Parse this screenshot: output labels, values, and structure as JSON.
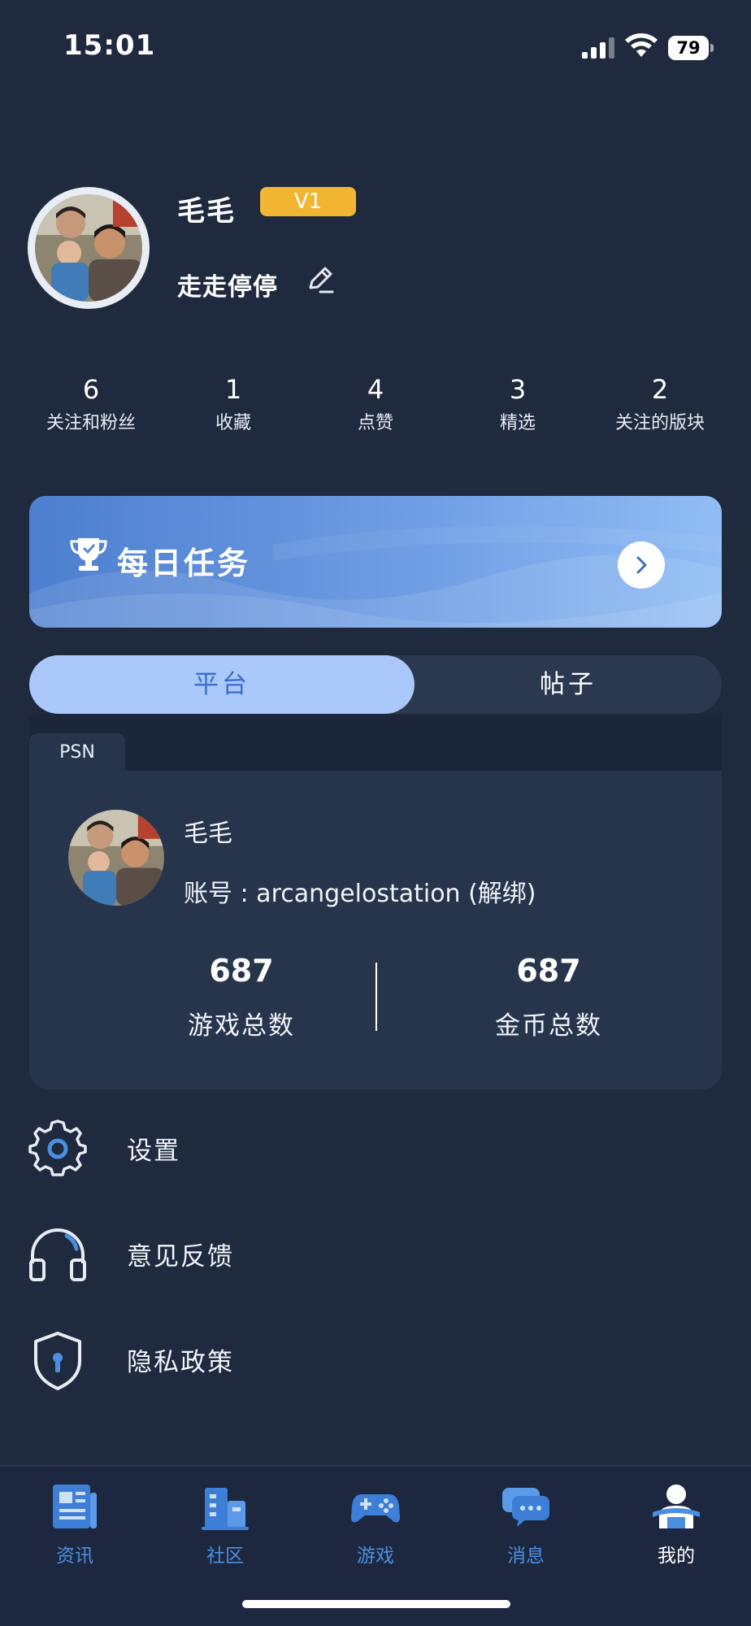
{
  "status_bar": {
    "time": "15:01",
    "battery": "79"
  },
  "profile": {
    "name": "毛毛",
    "level": "V1",
    "signature": "走走停停"
  },
  "stats": [
    {
      "value": "6",
      "label": "关注和粉丝"
    },
    {
      "value": "1",
      "label": "收藏"
    },
    {
      "value": "4",
      "label": "点赞"
    },
    {
      "value": "3",
      "label": "精选"
    },
    {
      "value": "2",
      "label": "关注的版块"
    }
  ],
  "daily_task": {
    "title": "每日任务"
  },
  "tabs": {
    "platform": "平台",
    "posts": "帖子",
    "selected": "平台"
  },
  "platform_panel": {
    "tab_label": "PSN",
    "name": "毛毛",
    "account": "账号 : arcangelostation (解绑)",
    "games_total": {
      "value": "687",
      "label": "游戏总数"
    },
    "coins_total": {
      "value": "687",
      "label": "金币总数"
    }
  },
  "menu": [
    {
      "label": "设置",
      "icon": "gear-icon"
    },
    {
      "label": "意见反馈",
      "icon": "headphones-icon"
    },
    {
      "label": "隐私政策",
      "icon": "shield-lock-icon"
    }
  ],
  "bottom_nav": [
    {
      "label": "资讯",
      "icon": "newspaper-icon"
    },
    {
      "label": "社区",
      "icon": "buildings-icon"
    },
    {
      "label": "游戏",
      "icon": "gamepad-icon"
    },
    {
      "label": "消息",
      "icon": "chat-bubbles-icon"
    },
    {
      "label": "我的",
      "icon": "person-icon",
      "active": true
    }
  ],
  "colors": {
    "background": "#1f2a3e",
    "accent_blue": "#4b8fe0",
    "badge_gold": "#f2b632",
    "tab_selected": "#aac8fa"
  }
}
